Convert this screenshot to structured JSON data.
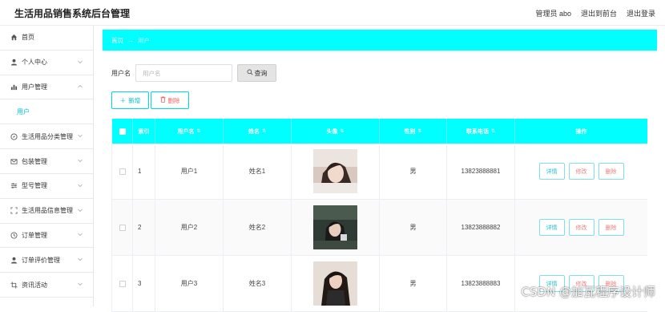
{
  "header": {
    "title": "生活用品销售系统后台管理",
    "admin_label": "管理员 abo",
    "exit_front": "退出到前台",
    "logout": "退出登录"
  },
  "sidebar": {
    "items": [
      {
        "label": "首页",
        "icon": "home-icon",
        "has_chevron": false
      },
      {
        "label": "个人中心",
        "icon": "user-icon",
        "has_chevron": true
      },
      {
        "label": "用户管理",
        "icon": "bar-chart-icon",
        "has_chevron": true,
        "expanded": true
      },
      {
        "label": "生活用品分类管理",
        "icon": "compass-icon",
        "has_chevron": true
      },
      {
        "label": "包装管理",
        "icon": "mail-icon",
        "has_chevron": true
      },
      {
        "label": "型号管理",
        "icon": "sliders-icon",
        "has_chevron": true
      },
      {
        "label": "生活用品信息管理",
        "icon": "frame-icon",
        "has_chevron": true
      },
      {
        "label": "订单管理",
        "icon": "clock-icon",
        "has_chevron": true
      },
      {
        "label": "订单评价管理",
        "icon": "user-icon",
        "has_chevron": true
      },
      {
        "label": "资讯活动",
        "icon": "crop-icon",
        "has_chevron": true
      }
    ],
    "sub_item": "用户"
  },
  "breadcrumb": {
    "home": "首页",
    "separator": "→",
    "current": "用户"
  },
  "search": {
    "label": "用户名",
    "placeholder": "用户名",
    "button": "查询"
  },
  "actions": {
    "add": "新增",
    "delete": "删除"
  },
  "table": {
    "columns": [
      "索引",
      "用户名",
      "姓名",
      "头像",
      "性别",
      "联系电话",
      "操作"
    ],
    "rows": [
      {
        "index": "1",
        "username": "用户1",
        "name": "姓名1",
        "gender": "男",
        "phone": "13823888881"
      },
      {
        "index": "2",
        "username": "用户2",
        "name": "姓名2",
        "gender": "男",
        "phone": "13823888882"
      },
      {
        "index": "3",
        "username": "用户3",
        "name": "姓名3",
        "gender": "男",
        "phone": "13823888883"
      }
    ],
    "row_actions": {
      "detail": "详情",
      "edit": "修改",
      "remove": "删除"
    }
  },
  "watermark": "CSDN @加瓦程序设计师",
  "colors": {
    "accent": "#00ffff",
    "accent_text": "#00c0cc",
    "danger": "#f06262"
  }
}
